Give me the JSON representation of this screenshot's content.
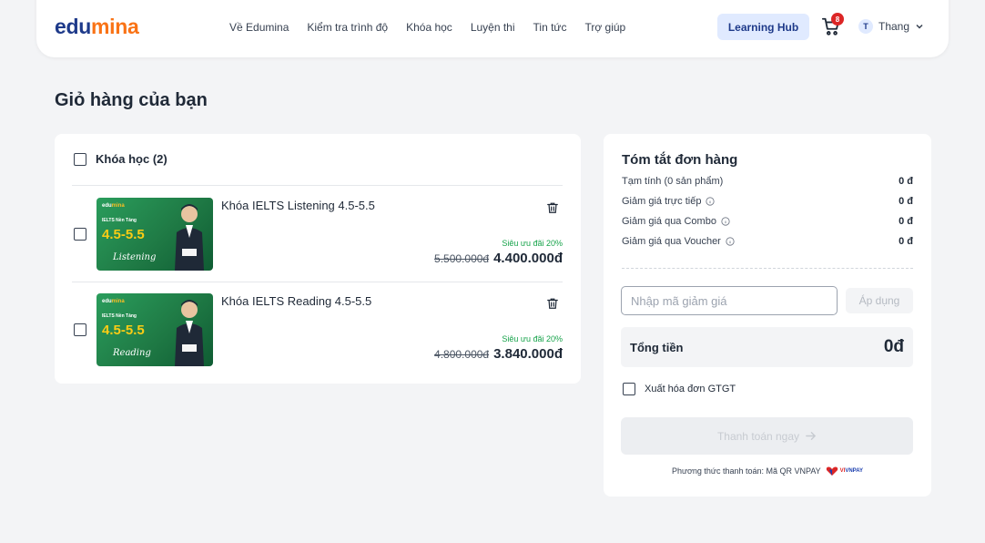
{
  "header": {
    "logo_part1": "edu",
    "logo_part2": "mina",
    "nav": [
      "Về Edumina",
      "Kiểm tra trình độ",
      "Khóa học",
      "Luyện thi",
      "Tin tức",
      "Trợ giúp"
    ],
    "hub_label": "Learning Hub",
    "cart_count": "8",
    "user_initial": "T",
    "user_name": "Thang"
  },
  "page_title": "Giỏ hàng của bạn",
  "cart": {
    "select_all_label": "Khóa học (2)",
    "items": [
      {
        "title": "Khóa IELTS Listening 4.5-5.5",
        "promo": "Siêu ưu đãi 20%",
        "old_price": "5.500.000đ",
        "new_price": "4.400.000đ",
        "thumb_brand_1": "edu",
        "thumb_brand_2": "mina",
        "thumb_tag": "IELTS Nền Tảng",
        "thumb_level": "4.5-5.5",
        "thumb_skill": "Listening"
      },
      {
        "title": "Khóa IELTS Reading 4.5-5.5",
        "promo": "Siêu ưu đãi 20%",
        "old_price": "4.800.000đ",
        "new_price": "3.840.000đ",
        "thumb_brand_1": "edu",
        "thumb_brand_2": "mina",
        "thumb_tag": "IELTS Nền Tảng",
        "thumb_level": "4.5-5.5",
        "thumb_skill": "Reading"
      }
    ]
  },
  "summary": {
    "title": "Tóm tắt đơn hàng",
    "rows": [
      {
        "label": "Tạm tính (0 sản phẩm)",
        "value": "0 đ"
      },
      {
        "label": "Giảm giá trực tiếp",
        "value": "0 đ"
      },
      {
        "label": "Giảm giá qua Combo",
        "value": "0 đ"
      },
      {
        "label": "Giảm giá qua Voucher",
        "value": "0 đ"
      }
    ],
    "coupon_placeholder": "Nhập mã giảm giá",
    "apply_label": "Áp dụng",
    "total_label": "Tổng tiền",
    "total_value": "0đ",
    "vat_label": "Xuất hóa đơn GTGT",
    "pay_label": "Thanh toán ngay",
    "pay_method": "Phương thức thanh toán: Mã QR VNPAY",
    "vnpay_logo_1": "VI",
    "vnpay_logo_2": "VNPAY"
  },
  "colors": {
    "brand_dark": "#1e3a8a",
    "brand_orange": "#f97316",
    "promo_green": "#16a34a",
    "badge_red": "#dc2626"
  }
}
